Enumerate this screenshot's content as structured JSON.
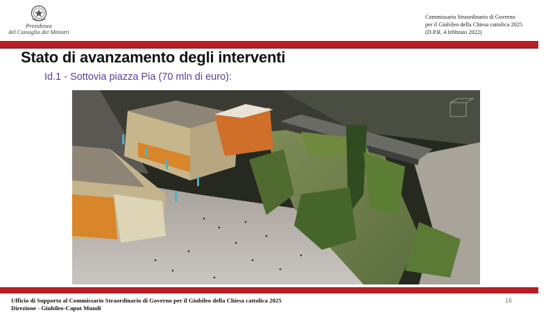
{
  "header": {
    "logo_line1": "Presidenza",
    "logo_line2": "del Consiglio dei Ministri",
    "right_line1": "Commissario Straordinario di Governo",
    "right_line2": "per il Giubileo della Chiesa cattolica 2025",
    "right_line3": "(D.P.R. 4 febbraio 2022)"
  },
  "slide": {
    "title": "Stato di avanzamento degli interventi",
    "subtitle": "Id.1 - Sottovia piazza Pia (70 mln di euro):"
  },
  "colors": {
    "accent_red": "#b81e22",
    "subtitle_purple": "#5b3a9c"
  },
  "footer": {
    "line1": "Ufficio di Supporto al Commissario Straordinario di Governo per il Giubileo della Chiesa cattolica 2025",
    "line2": "Direzione - Giubileo-Caput Mundi",
    "page_number": "16"
  }
}
